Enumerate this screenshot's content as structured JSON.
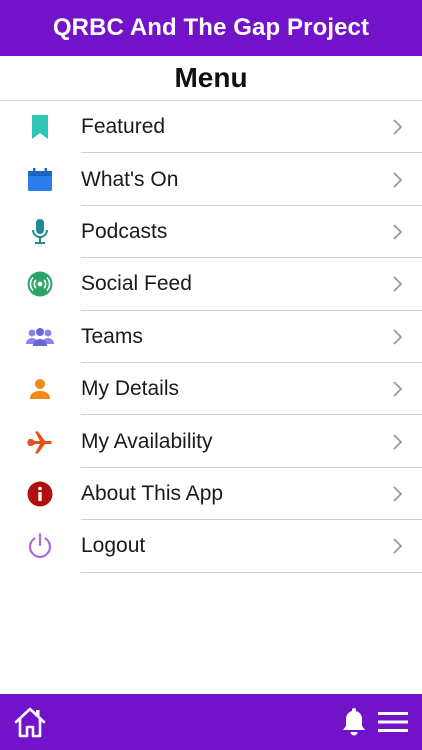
{
  "header": {
    "title": "QRBC And The Gap Project"
  },
  "menu": {
    "title": "Menu",
    "items": [
      {
        "label": "Featured",
        "icon": "bookmark-icon",
        "color": "#2ec4b6"
      },
      {
        "label": "What's On",
        "icon": "calendar-icon",
        "color": "#2b7de9"
      },
      {
        "label": "Podcasts",
        "icon": "microphone-icon",
        "color": "#1f8a94"
      },
      {
        "label": "Social Feed",
        "icon": "broadcast-icon",
        "color": "#2ea46a"
      },
      {
        "label": "Teams",
        "icon": "people-icon",
        "color": "#6a63d8"
      },
      {
        "label": "My Details",
        "icon": "user-icon",
        "color": "#f08a1c"
      },
      {
        "label": "My Availability",
        "icon": "plane-icon",
        "color": "#e0531c"
      },
      {
        "label": "About This App",
        "icon": "info-icon",
        "color": "#b0100f"
      },
      {
        "label": "Logout",
        "icon": "power-icon",
        "color": "#b06ad8"
      }
    ]
  },
  "footer": {
    "home_icon": "home-icon",
    "bell_icon": "bell-icon",
    "menu_icon": "hamburger-menu-icon"
  },
  "colors": {
    "brand": "#7212c9",
    "divider": "#cfcfcf",
    "chevron": "#9a9a9a"
  }
}
